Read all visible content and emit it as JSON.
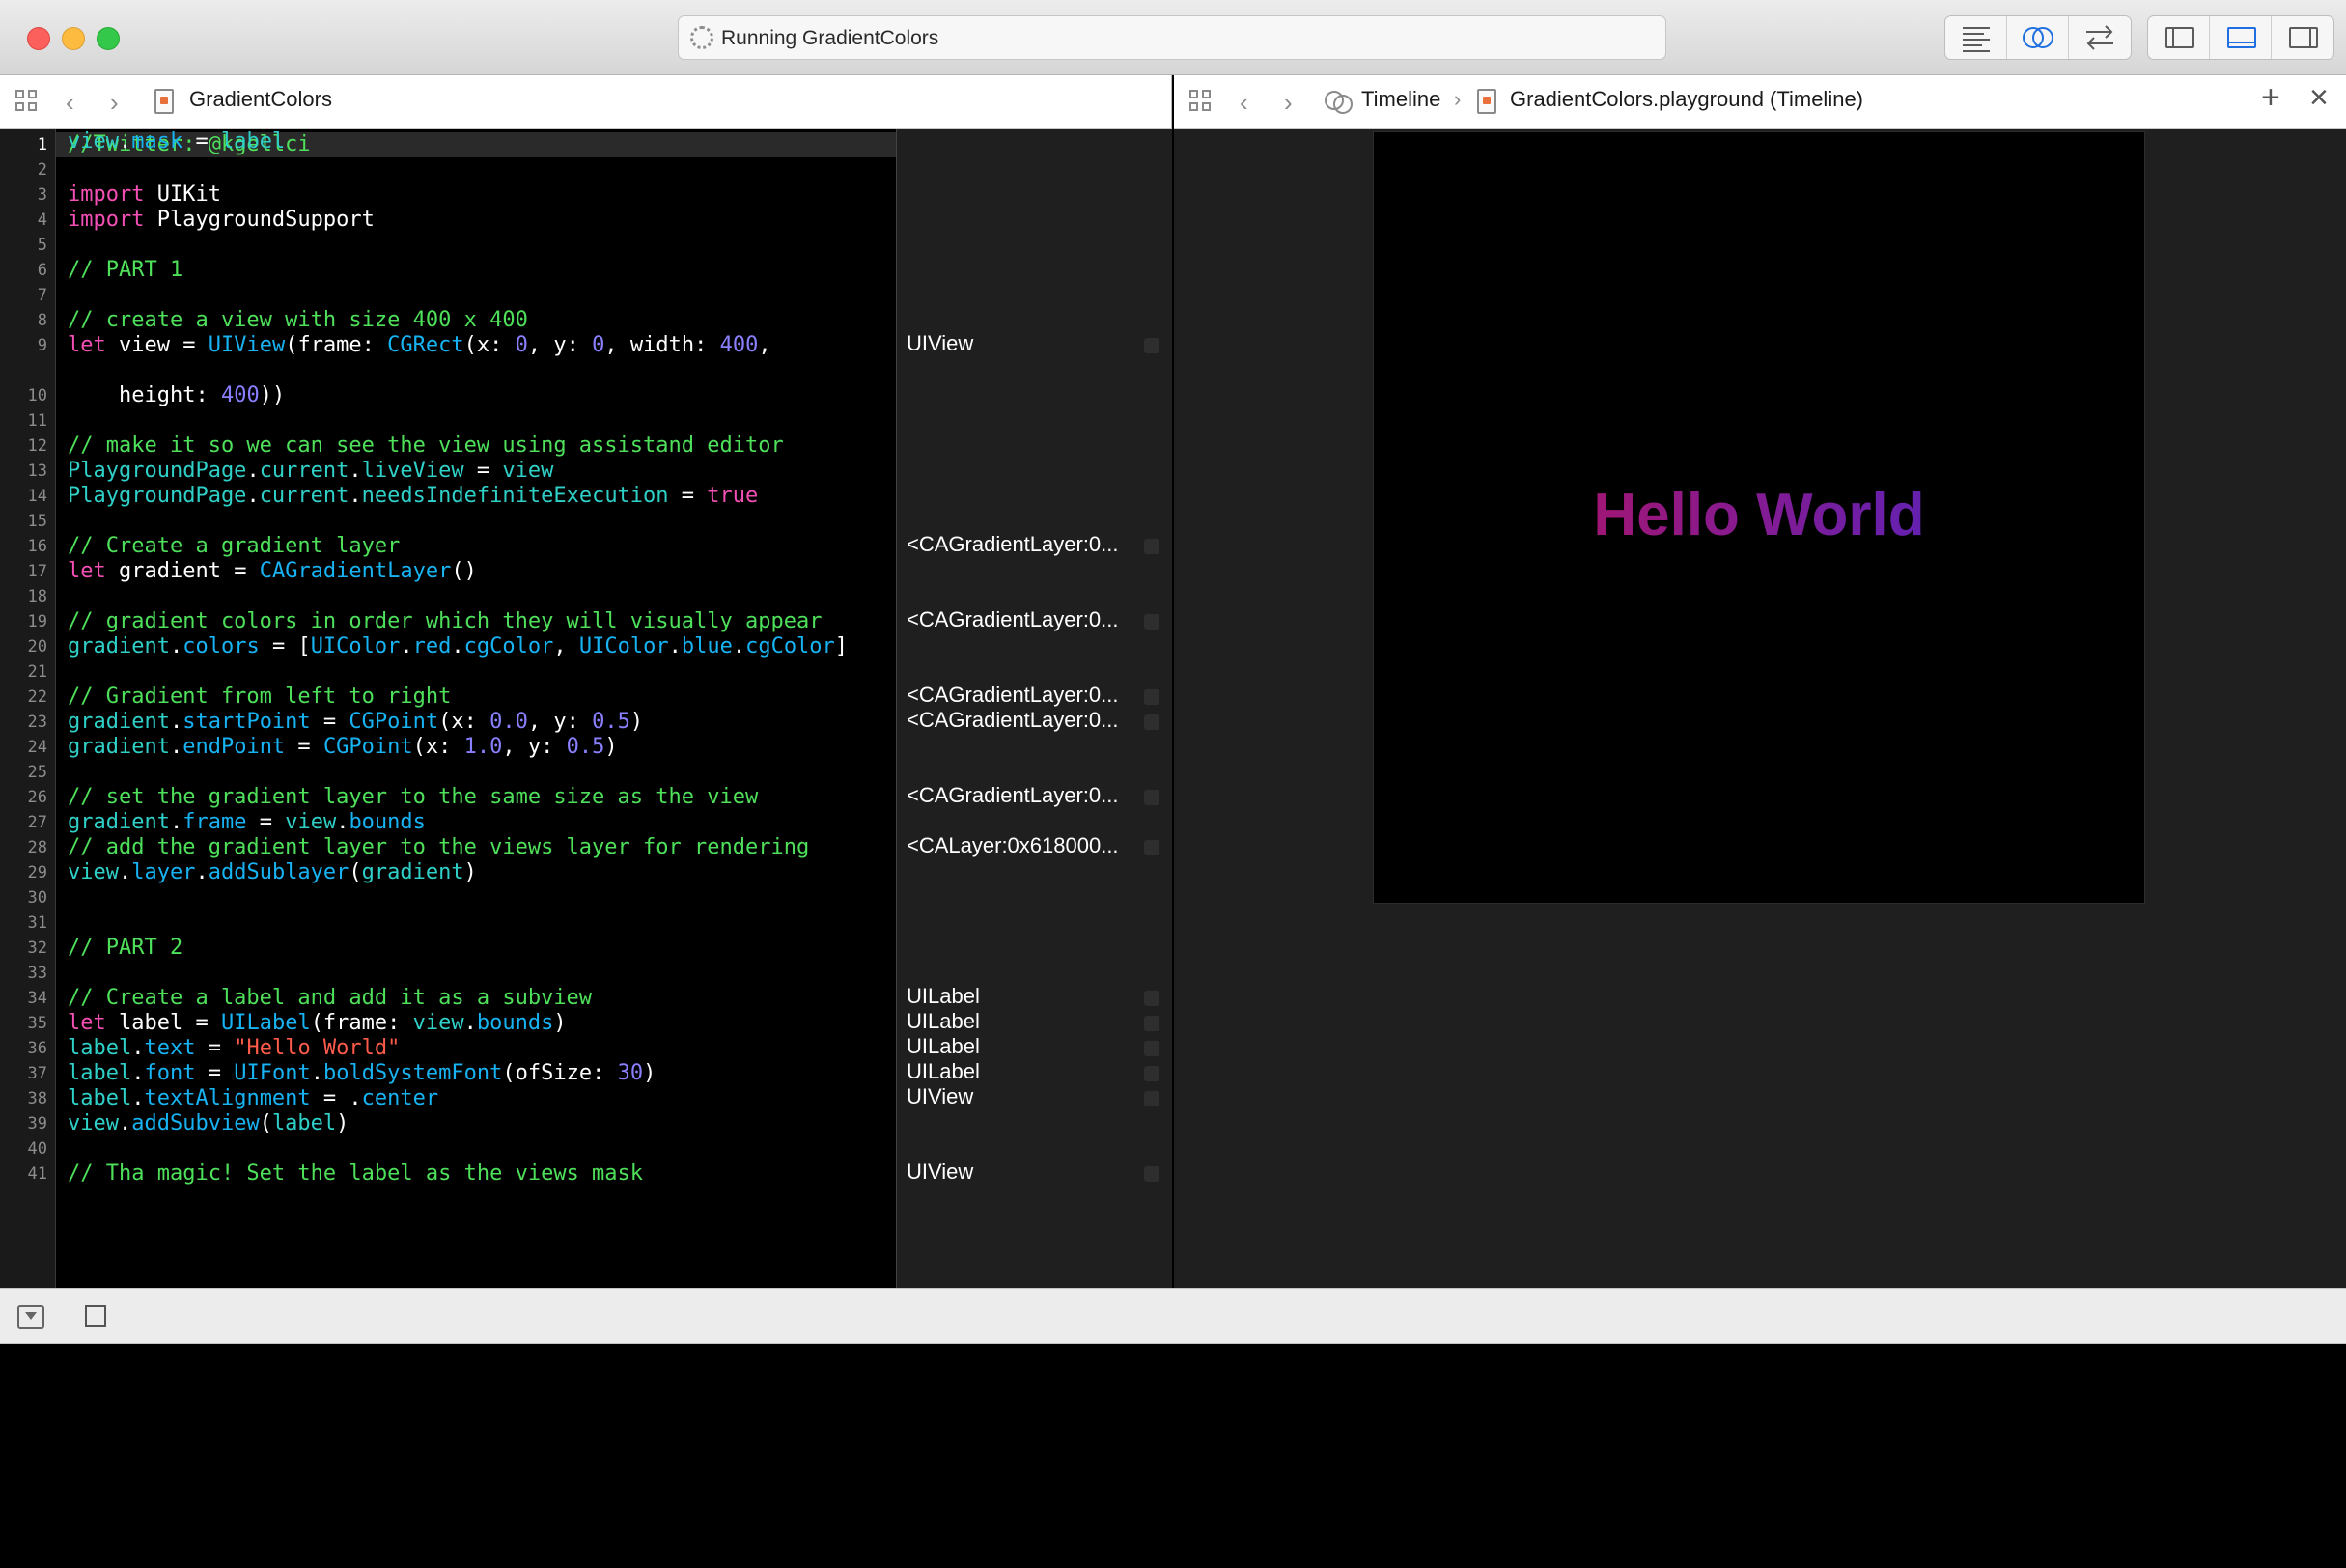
{
  "window": {
    "activity_text": "Running GradientColors"
  },
  "left_jumpbar": {
    "file_name": "GradientColors"
  },
  "right_jumpbar": {
    "section": "Timeline",
    "separator": "›",
    "file_name": "GradientColors.playground (Timeline)",
    "add_label": "+",
    "close_label": "×"
  },
  "nav": {
    "back": "‹",
    "forward": "›"
  },
  "editor": {
    "lines": [
      [
        {
          "t": "//Twitter: @kgellci",
          "c": "c-com"
        }
      ],
      [],
      [
        {
          "t": "import",
          "c": "c-kw"
        },
        {
          "t": " UIKit",
          "c": ""
        }
      ],
      [
        {
          "t": "import",
          "c": "c-kw"
        },
        {
          "t": " PlaygroundSupport",
          "c": ""
        }
      ],
      [],
      [
        {
          "t": "// PART 1",
          "c": "c-com"
        }
      ],
      [],
      [
        {
          "t": "// create a view with size 400 x 400",
          "c": "c-com"
        }
      ],
      [
        {
          "t": "let",
          "c": "c-kw"
        },
        {
          "t": " view = ",
          "c": ""
        },
        {
          "t": "UIView",
          "c": "c-type"
        },
        {
          "t": "(frame: ",
          "c": ""
        },
        {
          "t": "CGRect",
          "c": "c-type"
        },
        {
          "t": "(x: ",
          "c": ""
        },
        {
          "t": "0",
          "c": "c-num"
        },
        {
          "t": ", y: ",
          "c": ""
        },
        {
          "t": "0",
          "c": "c-num"
        },
        {
          "t": ", width: ",
          "c": ""
        },
        {
          "t": "400",
          "c": "c-num"
        },
        {
          "t": ",",
          "c": ""
        }
      ],
      [
        {
          "t": "    height: ",
          "c": ""
        },
        {
          "t": "400",
          "c": "c-num"
        },
        {
          "t": "))",
          "c": ""
        }
      ],
      [],
      [
        {
          "t": "// make it so we can see the view using assistand editor",
          "c": "c-com"
        }
      ],
      [
        {
          "t": "PlaygroundPage",
          "c": "c-prop"
        },
        {
          "t": ".",
          "c": ""
        },
        {
          "t": "current",
          "c": "c-prop"
        },
        {
          "t": ".",
          "c": ""
        },
        {
          "t": "liveView",
          "c": "c-prop"
        },
        {
          "t": " = ",
          "c": ""
        },
        {
          "t": "view",
          "c": "c-prop"
        }
      ],
      [
        {
          "t": "PlaygroundPage",
          "c": "c-prop"
        },
        {
          "t": ".",
          "c": ""
        },
        {
          "t": "current",
          "c": "c-prop"
        },
        {
          "t": ".",
          "c": ""
        },
        {
          "t": "needsIndefiniteExecution",
          "c": "c-prop"
        },
        {
          "t": " = ",
          "c": ""
        },
        {
          "t": "true",
          "c": "c-kw"
        }
      ],
      [],
      [
        {
          "t": "// Create a gradient layer",
          "c": "c-com"
        }
      ],
      [
        {
          "t": "let",
          "c": "c-kw"
        },
        {
          "t": " gradient = ",
          "c": ""
        },
        {
          "t": "CAGradientLayer",
          "c": "c-type"
        },
        {
          "t": "()",
          "c": ""
        }
      ],
      [],
      [
        {
          "t": "// gradient colors in order which they will visually appear",
          "c": "c-com"
        }
      ],
      [
        {
          "t": "gradient",
          "c": "c-prop"
        },
        {
          "t": ".",
          "c": ""
        },
        {
          "t": "colors",
          "c": "c-type"
        },
        {
          "t": " = [",
          "c": ""
        },
        {
          "t": "UIColor",
          "c": "c-type"
        },
        {
          "t": ".",
          "c": ""
        },
        {
          "t": "red",
          "c": "c-type"
        },
        {
          "t": ".",
          "c": ""
        },
        {
          "t": "cgColor",
          "c": "c-type"
        },
        {
          "t": ", ",
          "c": ""
        },
        {
          "t": "UIColor",
          "c": "c-type"
        },
        {
          "t": ".",
          "c": ""
        },
        {
          "t": "blue",
          "c": "c-type"
        },
        {
          "t": ".",
          "c": ""
        },
        {
          "t": "cgColor",
          "c": "c-type"
        },
        {
          "t": "]",
          "c": ""
        }
      ],
      [],
      [
        {
          "t": "// Gradient from left to right",
          "c": "c-com"
        }
      ],
      [
        {
          "t": "gradient",
          "c": "c-prop"
        },
        {
          "t": ".",
          "c": ""
        },
        {
          "t": "startPoint",
          "c": "c-type"
        },
        {
          "t": " = ",
          "c": ""
        },
        {
          "t": "CGPoint",
          "c": "c-type"
        },
        {
          "t": "(x: ",
          "c": ""
        },
        {
          "t": "0.0",
          "c": "c-num"
        },
        {
          "t": ", y: ",
          "c": ""
        },
        {
          "t": "0.5",
          "c": "c-num"
        },
        {
          "t": ")",
          "c": ""
        }
      ],
      [
        {
          "t": "gradient",
          "c": "c-prop"
        },
        {
          "t": ".",
          "c": ""
        },
        {
          "t": "endPoint",
          "c": "c-type"
        },
        {
          "t": " = ",
          "c": ""
        },
        {
          "t": "CGPoint",
          "c": "c-type"
        },
        {
          "t": "(x: ",
          "c": ""
        },
        {
          "t": "1.0",
          "c": "c-num"
        },
        {
          "t": ", y: ",
          "c": ""
        },
        {
          "t": "0.5",
          "c": "c-num"
        },
        {
          "t": ")",
          "c": ""
        }
      ],
      [],
      [
        {
          "t": "// set the gradient layer to the same size as the view",
          "c": "c-com"
        }
      ],
      [
        {
          "t": "gradient",
          "c": "c-prop"
        },
        {
          "t": ".",
          "c": ""
        },
        {
          "t": "frame",
          "c": "c-type"
        },
        {
          "t": " = ",
          "c": ""
        },
        {
          "t": "view",
          "c": "c-prop"
        },
        {
          "t": ".",
          "c": ""
        },
        {
          "t": "bounds",
          "c": "c-type"
        }
      ],
      [
        {
          "t": "// add the gradient layer to the views layer for rendering",
          "c": "c-com"
        }
      ],
      [
        {
          "t": "view",
          "c": "c-prop"
        },
        {
          "t": ".",
          "c": ""
        },
        {
          "t": "layer",
          "c": "c-type"
        },
        {
          "t": ".",
          "c": ""
        },
        {
          "t": "addSublayer",
          "c": "c-type"
        },
        {
          "t": "(",
          "c": ""
        },
        {
          "t": "gradient",
          "c": "c-prop"
        },
        {
          "t": ")",
          "c": ""
        }
      ],
      [],
      [],
      [
        {
          "t": "// PART 2",
          "c": "c-com"
        }
      ],
      [],
      [
        {
          "t": "// Create a label and add it as a subview",
          "c": "c-com"
        }
      ],
      [
        {
          "t": "let",
          "c": "c-kw"
        },
        {
          "t": " label = ",
          "c": ""
        },
        {
          "t": "UILabel",
          "c": "c-type"
        },
        {
          "t": "(frame: ",
          "c": ""
        },
        {
          "t": "view",
          "c": "c-prop"
        },
        {
          "t": ".",
          "c": ""
        },
        {
          "t": "bounds",
          "c": "c-type"
        },
        {
          "t": ")",
          "c": ""
        }
      ],
      [
        {
          "t": "label",
          "c": "c-prop"
        },
        {
          "t": ".",
          "c": ""
        },
        {
          "t": "text",
          "c": "c-type"
        },
        {
          "t": " = ",
          "c": ""
        },
        {
          "t": "\"Hello World\"",
          "c": "c-str"
        }
      ],
      [
        {
          "t": "label",
          "c": "c-prop"
        },
        {
          "t": ".",
          "c": ""
        },
        {
          "t": "font",
          "c": "c-type"
        },
        {
          "t": " = ",
          "c": ""
        },
        {
          "t": "UIFont",
          "c": "c-type"
        },
        {
          "t": ".",
          "c": ""
        },
        {
          "t": "boldSystemFont",
          "c": "c-type"
        },
        {
          "t": "(ofSize: ",
          "c": ""
        },
        {
          "t": "30",
          "c": "c-num"
        },
        {
          "t": ")",
          "c": ""
        }
      ],
      [
        {
          "t": "label",
          "c": "c-prop"
        },
        {
          "t": ".",
          "c": ""
        },
        {
          "t": "textAlignment",
          "c": "c-type"
        },
        {
          "t": " = .",
          "c": ""
        },
        {
          "t": "center",
          "c": "c-type"
        }
      ],
      [
        {
          "t": "view",
          "c": "c-prop"
        },
        {
          "t": ".",
          "c": ""
        },
        {
          "t": "addSubview",
          "c": "c-type"
        },
        {
          "t": "(",
          "c": ""
        },
        {
          "t": "label",
          "c": "c-prop"
        },
        {
          "t": ")",
          "c": ""
        }
      ],
      [],
      [
        {
          "t": "// Tha magic! Set the label as the views mask",
          "c": "c-com"
        }
      ],
      [
        {
          "t": "view",
          "c": "c-prop"
        },
        {
          "t": ".",
          "c": ""
        },
        {
          "t": "mask",
          "c": "c-type"
        },
        {
          "t": " = ",
          "c": ""
        },
        {
          "t": "label",
          "c": "c-prop"
        }
      ]
    ],
    "line_numbers": [
      "1",
      "2",
      "3",
      "4",
      "5",
      "6",
      "7",
      "8",
      "9",
      "",
      "10",
      "11",
      "12",
      "13",
      "14",
      "15",
      "16",
      "17",
      "18",
      "19",
      "20",
      "21",
      "22",
      "23",
      "24",
      "25",
      "26",
      "27",
      "28",
      "29",
      "30",
      "31",
      "32",
      "33",
      "34",
      "35",
      "36",
      "37",
      "38",
      "39",
      "40",
      "41"
    ],
    "current_line": "1"
  },
  "results": [
    {
      "line": 9,
      "text": "UIView"
    },
    {
      "line": 16,
      "text": "<CAGradientLayer:0..."
    },
    {
      "line": 19,
      "text": "<CAGradientLayer:0..."
    },
    {
      "line": 22,
      "text": "<CAGradientLayer:0..."
    },
    {
      "line": 23,
      "text": "<CAGradientLayer:0..."
    },
    {
      "line": 26,
      "text": "<CAGradientLayer:0..."
    },
    {
      "line": 28,
      "text": "<CALayer:0x618000..."
    },
    {
      "line": 34,
      "text": "UILabel"
    },
    {
      "line": 35,
      "text": "UILabel"
    },
    {
      "line": 36,
      "text": "UILabel"
    },
    {
      "line": 37,
      "text": "UILabel"
    },
    {
      "line": 38,
      "text": "UIView"
    },
    {
      "line": 41,
      "text": "UIView"
    }
  ],
  "live_view": {
    "text": "Hello World",
    "gradient_colors": [
      "#c4104e",
      "#3a28d6"
    ]
  }
}
